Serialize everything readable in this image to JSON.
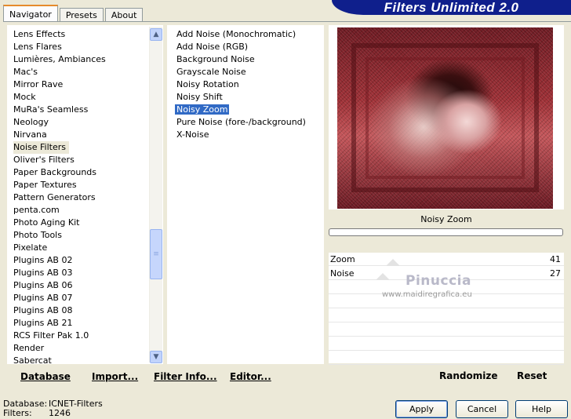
{
  "tabs": [
    {
      "label": "Navigator",
      "active": true
    },
    {
      "label": "Presets",
      "active": false
    },
    {
      "label": "About",
      "active": false
    }
  ],
  "brand": {
    "title": "Filters Unlimited 2.0"
  },
  "categories": {
    "items": [
      "Lens Effects",
      "Lens Flares",
      "Lumières, Ambiances",
      "Mac's",
      "Mirror Rave",
      "Mock",
      "MuRa's Seamless",
      "Neology",
      "Nirvana",
      "Noise Filters",
      "Oliver's Filters",
      "Paper Backgrounds",
      "Paper Textures",
      "Pattern Generators",
      "penta.com",
      "Photo Aging Kit",
      "Photo Tools",
      "Pixelate",
      "Plugins AB 02",
      "Plugins AB 03",
      "Plugins AB 06",
      "Plugins AB 07",
      "Plugins AB 08",
      "Plugins AB 21",
      "RCS Filter Pak 1.0",
      "Render",
      "Sabercat"
    ],
    "selected": "Noise Filters",
    "scroll_up_icon": "arrow-up-icon",
    "scroll_down_icon": "arrow-down-icon"
  },
  "filters": {
    "items": [
      "Add Noise (Monochromatic)",
      "Add Noise (RGB)",
      "Background Noise",
      "Grayscale Noise",
      "Noisy Rotation",
      "Noisy Shift",
      "Noisy Zoom",
      "Pure Noise (fore-/background)",
      "X-Noise"
    ],
    "selected": "Noisy Zoom"
  },
  "left_actions": {
    "database": "Database",
    "import": "Import...",
    "filter_info": "Filter Info...",
    "editor": "Editor..."
  },
  "preview": {
    "filter_name": "Noisy Zoom"
  },
  "params": [
    {
      "label": "Zoom",
      "value": "41",
      "level": 41
    },
    {
      "label": "Noise",
      "value": "27",
      "level": 27
    }
  ],
  "watermark": {
    "title": "Pinuccia",
    "url": "www.maidiregrafica.eu"
  },
  "right_actions": {
    "randomize": "Randomize",
    "reset": "Reset"
  },
  "footer": {
    "database_label": "Database:",
    "database_value": "ICNET-Filters",
    "filters_label": "Filters:",
    "filters_value": "1246"
  },
  "buttons": {
    "apply": "Apply",
    "cancel": "Cancel",
    "help": "Help"
  },
  "colors": {
    "brand_bar": "#0f1f8c",
    "selection": "#316ac5",
    "active_tab_accent": "#e68b2c"
  }
}
